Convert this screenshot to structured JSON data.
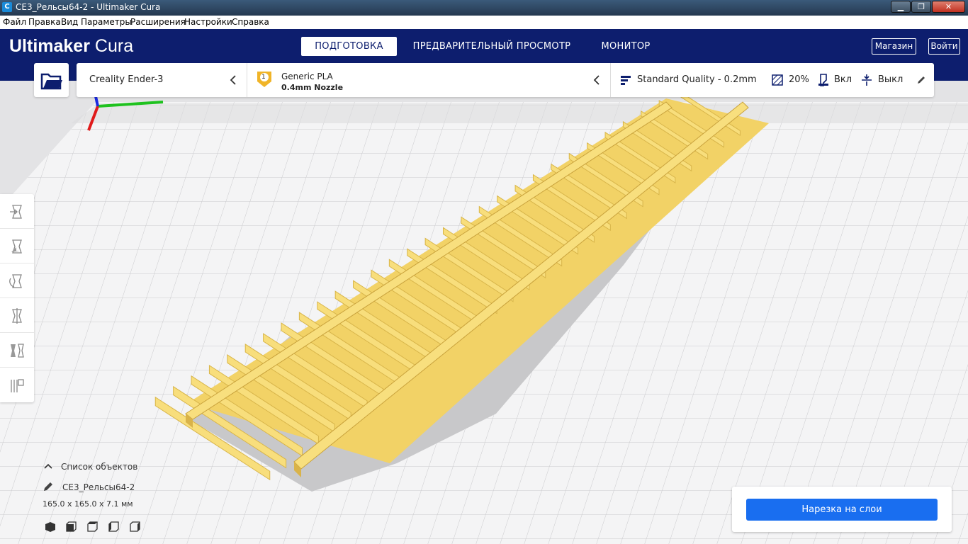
{
  "window": {
    "title": "CE3_Рельсы64-2 - Ultimaker Cura",
    "app_icon": "C",
    "minimize": "▁",
    "maximize": "❐",
    "close": "✕"
  },
  "menu": [
    "Файл",
    "Правка",
    "Вид",
    "Параметры",
    "Расширения",
    "Настройки",
    "Справка"
  ],
  "header": {
    "logo_brand": "Ultimaker",
    "logo_product": "Cura",
    "tabs": [
      {
        "label": "ПОДГОТОВКА",
        "active": true
      },
      {
        "label": "ПРЕДВАРИТЕЛЬНЫЙ ПРОСМОТР",
        "active": false
      },
      {
        "label": "МОНИТОР",
        "active": false
      }
    ],
    "marketplace_label": "Магазин",
    "signin_label": "Войти"
  },
  "toolbar": {
    "printer": "Creality Ender-3",
    "extruder_number": "1",
    "material": "Generic PLA",
    "nozzle": "0.4mm Nozzle",
    "quality": "Standard Quality - 0.2mm",
    "infill": "20%",
    "support": "Вкл",
    "adhesion": "Выкл"
  },
  "objects": {
    "header": "Список объектов",
    "name": "CE3_Рельсы64-2",
    "dimensions": "165.0 x 165.0 x 7.1 мм"
  },
  "slice_button": "Нарезка на слои",
  "colors": {
    "header_bg": "#0d1e6e",
    "accent": "#196ef0",
    "model": "#f5d76e"
  }
}
